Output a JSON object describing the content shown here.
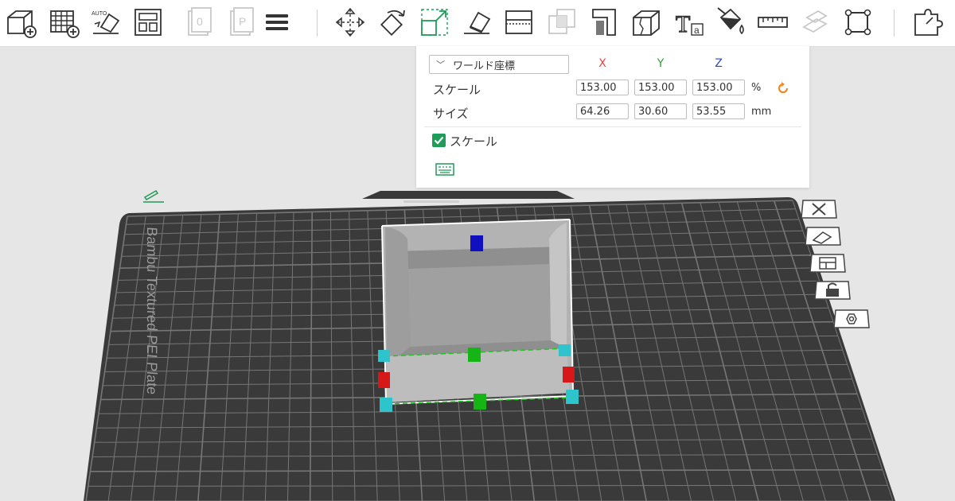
{
  "toolbar": {
    "icons": [
      "add-object-icon",
      "add-plate-icon",
      "auto-orient-icon",
      "arrange-icon",
      "object-tab-icon",
      "plate-tab-icon",
      "layers-list-icon",
      "move-icon",
      "rotate-icon",
      "scale-icon",
      "lay-on-face-icon",
      "cut-icon",
      "boolean-icon",
      "support-paint-icon",
      "seam-paint-icon",
      "mesh-box-icon",
      "text-icon",
      "color-paint-icon",
      "measure-icon",
      "assembly-icon",
      "fit-view-icon",
      "split-parts-icon"
    ]
  },
  "scale_panel": {
    "coordinate_system": "ワールド座標",
    "axes": {
      "x": "X",
      "y": "Y",
      "z": "Z"
    },
    "scale": {
      "label": "スケール",
      "x": "153.00",
      "y": "153.00",
      "z": "153.00",
      "unit": "%"
    },
    "size": {
      "label": "サイズ",
      "x": "64.26",
      "y": "30.60",
      "z": "53.55",
      "unit": "mm"
    },
    "uniform_scale": {
      "label": "スケール",
      "checked": true
    }
  },
  "plate": {
    "label": "Bambu Textured PEI Plate"
  },
  "colors": {
    "axis_x": "#e8453c",
    "axis_y": "#2ca02c",
    "axis_z": "#3046c8",
    "checkbox": "#1f9c57",
    "plate": "#3a3a3a",
    "grid": "#8a8a8a",
    "model": "#a9a9a9",
    "reset": "#f08a24"
  }
}
